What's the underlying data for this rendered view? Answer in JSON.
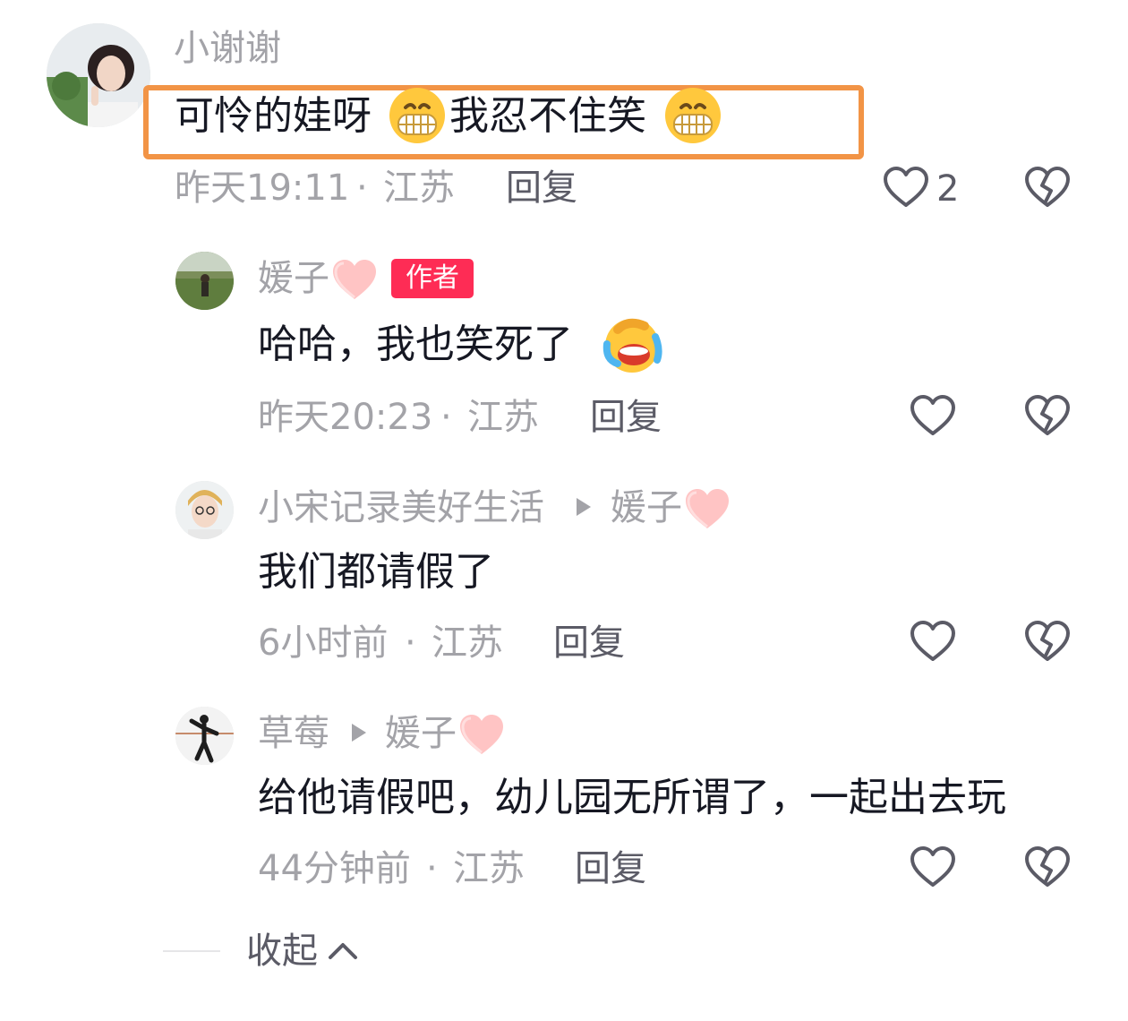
{
  "comments": {
    "top": {
      "username": "小谢谢",
      "text_part1": "可怜的娃呀",
      "text_part2": "我忍不住笑",
      "time": "昨天19:11",
      "sep": "·",
      "location": "江苏",
      "reply_label": "回复",
      "like_count": "2"
    },
    "replies": [
      {
        "username": "媛子",
        "badge": "作者",
        "text": "哈哈，我也笑死了",
        "time": "昨天20:23",
        "sep": "·",
        "location": "江苏",
        "reply_label": "回复"
      },
      {
        "username": "小宋记录美好生活",
        "reply_to": "媛子",
        "text": "我们都请假了",
        "time": "6小时前",
        "sep": "·",
        "location": "江苏",
        "reply_label": "回复"
      },
      {
        "username": "草莓",
        "reply_to": "媛子",
        "text": "给他请假吧，幼儿园无所谓了，一起出去玩",
        "time": "44分钟前",
        "sep": "·",
        "location": "江苏",
        "reply_label": "回复"
      }
    ]
  },
  "collapse": {
    "label": "收起"
  },
  "colors": {
    "highlight_border": "#f29446",
    "author_badge": "#fe2c55",
    "meta_gray": "#a3a3a8",
    "text_dark": "#161823",
    "icon_gray": "#5b5b66"
  },
  "icons": {
    "like": "heart-outline-icon",
    "dislike": "broken-heart-icon",
    "reply_arrow": "triangle-right-icon",
    "collapse": "chevron-up-icon",
    "emoji_grin": "grinning-face-emoji",
    "emoji_laugh": "laughing-crying-face-emoji",
    "emoji_heart": "pink-heart-emoji"
  }
}
